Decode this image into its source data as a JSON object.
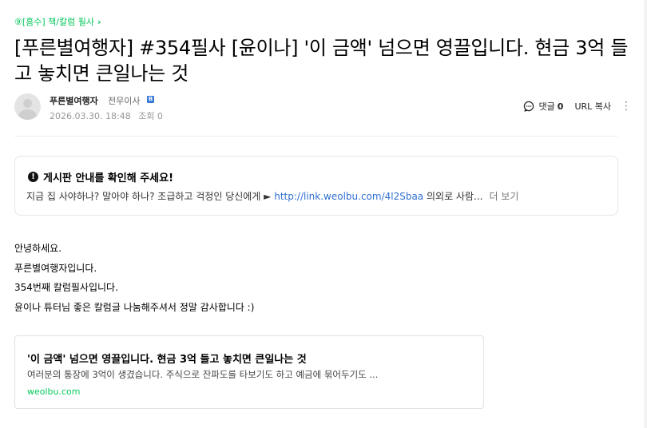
{
  "board": {
    "label": "⑨[흠수] 책/칼럼 필사",
    "chevron": "›"
  },
  "post": {
    "title": "[푸른별여행자] #354필사 [윤이나] '이 금액' 넘으면 영끌입니다. 현금 3억 들고 놓치면 큰일나는 것"
  },
  "author": {
    "name": "푸른별여행자",
    "rank": "전무이사",
    "rank_badge": "B",
    "date": "2026.03.30. 18:48",
    "views": "조회 0"
  },
  "actions": {
    "comment_label": "댓글",
    "comment_count": "0",
    "url_copy": "URL 복사",
    "more": "⋮"
  },
  "notice": {
    "title": "게시판 안내를 확인해 주세요!",
    "body_prefix": "지금 집 사야하나? 말아야 하나? 조급하고 걱정인 당신에게 ► ",
    "link": "http://link.weolbu.com/4l2Sbaa",
    "body_suffix": " 의외로 사람...",
    "more": "더 보기"
  },
  "content": {
    "lines": [
      "안녕하세요.",
      "푸른별여행자입니다.",
      "354번째 칼럼필사입니다.",
      "윤이나 튜터님 좋은 칼럼글 나눔해주셔서 정말 감사합니다 :)"
    ]
  },
  "og_card": {
    "title": "'이 금액' 넘으면 영끌입니다. 현금 3억 들고 놓치면 큰일나는 것",
    "description": "여러분의 통장에 3억이 생겼습니다. 주식으로 잔파도를 타보기도 하고 예금에 묶어두기도 ...",
    "domain": "weolbu.com"
  },
  "colors": {
    "accent": "#03c75a",
    "link": "#2f6fd0"
  },
  "icons": {
    "comment": "comment-icon",
    "info": "info-icon",
    "avatar": "avatar-placeholder"
  }
}
